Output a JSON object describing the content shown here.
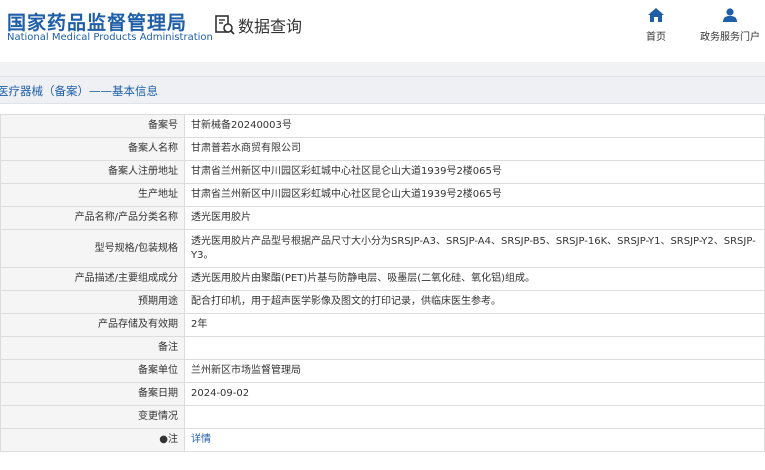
{
  "header": {
    "logo_cn": "国家药品监督管理局",
    "logo_en": "National Medical Products Administration",
    "query_title": "数据查询",
    "query_icon": "search-document-icon",
    "nav": [
      {
        "label": "首页",
        "icon": "home-icon"
      },
      {
        "label": "政务服务门户",
        "icon": "user-icon"
      }
    ]
  },
  "section_title": "医疗器械（备案）——基本信息",
  "rows": [
    {
      "label": "备案号",
      "value": "甘新械备20240003号"
    },
    {
      "label": "备案人名称",
      "value": "甘肃普若水商贸有限公司"
    },
    {
      "label": "备案人注册地址",
      "value": "甘肃省兰州新区中川园区彩虹城中心社区昆仑山大道1939号2楼065号"
    },
    {
      "label": "生产地址",
      "value": "甘肃省兰州新区中川园区彩虹城中心社区昆仑山大道1939号2楼065号"
    },
    {
      "label": "产品名称/产品分类名称",
      "value": "透光医用胶片"
    },
    {
      "label": "型号规格/包装规格",
      "value": "透光医用胶片产品型号根据产品尺寸大小分为SRSJP-A3、SRSJP-A4、SRSJP-B5、SRSJP-16K、SRSJP-Y1、SRSJP-Y2、SRSJP-Y3。"
    },
    {
      "label": "产品描述/主要组成成分",
      "value": "透光医用胶片由聚酯(PET)片基与防静电层、吸墨层(二氧化硅、氧化铝)组成。"
    },
    {
      "label": "预期用途",
      "value": "配合打印机，用于超声医学影像及图文的打印记录，供临床医生参考。"
    },
    {
      "label": "产品存储及有效期",
      "value": "2年"
    },
    {
      "label": "备注",
      "value": ""
    },
    {
      "label": "备案单位",
      "value": "兰州新区市场监督管理局"
    },
    {
      "label": "备案日期",
      "value": "2024-09-02"
    },
    {
      "label": "变更情况",
      "value": ""
    },
    {
      "label": "●注",
      "value": "详情"
    }
  ],
  "colors": {
    "brand": "#1f5fa8",
    "label_bg": "#f5f5f5",
    "section_bg": "#eef0f4"
  }
}
